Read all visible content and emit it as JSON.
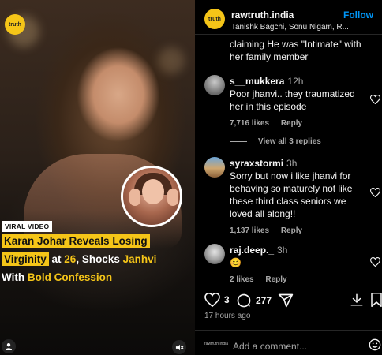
{
  "media": {
    "brand_badge": "truth",
    "viral_tag": "VIRAL VIDEO",
    "headline": {
      "line1": "Karan Johar Reveals Losing",
      "line2_a": "Virginity",
      "line2_b": " at ",
      "line2_c": "26",
      "line2_d": ", Shocks ",
      "line2_e": "Janhvi",
      "line3_a": "With ",
      "line3_b": "Bold Confession"
    },
    "user_tag_icon": "person-icon",
    "mute_icon": "speaker-muted-icon"
  },
  "post": {
    "username": "rawtruth.india",
    "follow_label": "Follow",
    "subtitle": "Tanishk Bagchi, Sonu Nigam, R...",
    "avatar_text": "truth"
  },
  "comments": {
    "clipped_text": "claiming He was \"Intimate\" with her family member",
    "items": [
      {
        "user": "s__mukkera",
        "time": "12h",
        "text": "Poor jhanvi.. they traumatized her in this episode",
        "likes": "7,716 likes",
        "reply": "Reply"
      },
      {
        "user": "syraxstormi",
        "time": "3h",
        "text": "Sorry but now i like jhanvi for behaving so maturely not like these third class seniors we loved all along!!",
        "likes": "1,137 likes",
        "reply": "Reply"
      },
      {
        "user": "raj.deep._",
        "time": "3h",
        "text": "😊",
        "likes": "2 likes",
        "reply": "Reply"
      }
    ],
    "view_replies": "View all 3 replies"
  },
  "actions": {
    "like_count": "3",
    "comment_count": "277",
    "time_ago": "17 hours ago"
  },
  "add_comment": {
    "placeholder": "Add a comment...",
    "tag": "rawtruth.india"
  },
  "colors": {
    "accent_yellow": "#f5c518",
    "follow_blue": "#0095f6",
    "muted_text": "#a8a8a8"
  }
}
